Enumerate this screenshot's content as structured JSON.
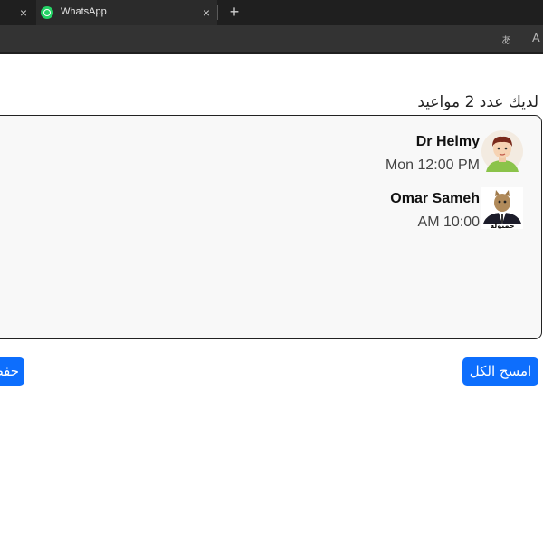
{
  "browser": {
    "prev_tab_close": "×",
    "tab_title": "WhatsApp",
    "tab_close": "×",
    "new_tab": "+",
    "toolbar_translate_icon": "あ",
    "toolbar_read_aloud_icon": "A"
  },
  "page": {
    "heading": "لديك عدد 2 مواعيد",
    "appointments": [
      {
        "name": "Dr Helmy",
        "time": "Mon 12:00 PM",
        "avatar": "cartoon-man-avatar"
      },
      {
        "name": "Omar Sameh",
        "time": "AM 10:00",
        "avatar": "cat-in-suit-avatar",
        "avatar_caption": "حمبوله"
      }
    ],
    "clear_all_label": "امسح الكل",
    "save_label": "حفظ"
  },
  "colors": {
    "primary": "#0d6efd",
    "card_bg": "#f8f8f8",
    "tabbar_bg": "#1f1f1f",
    "whatsapp_green": "#25d366"
  }
}
